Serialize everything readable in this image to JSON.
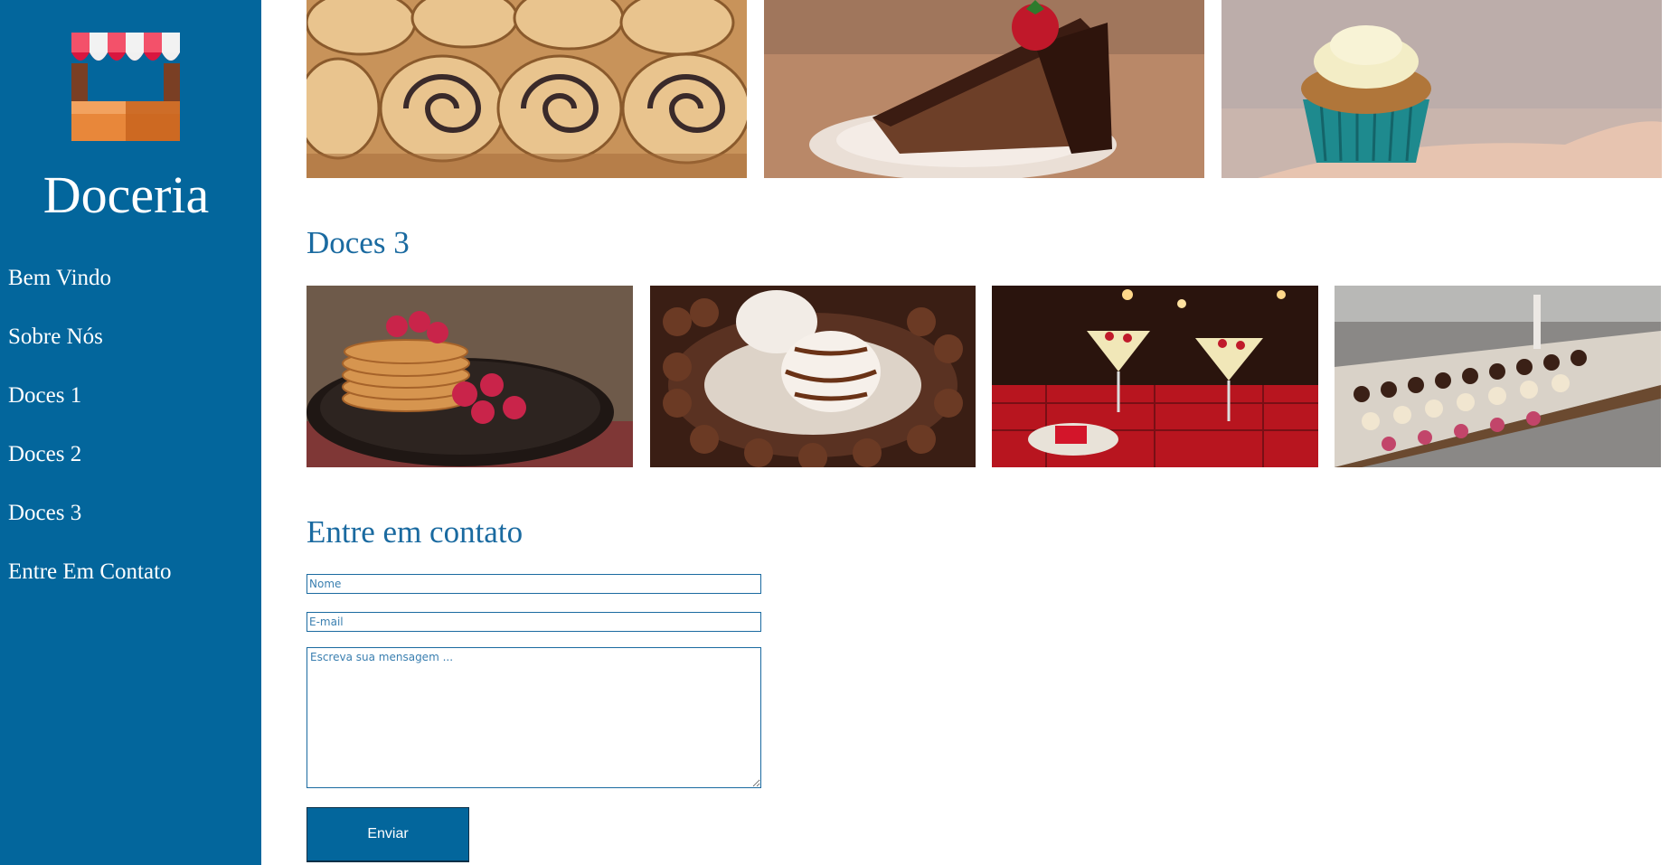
{
  "brand": {
    "logo_icon": "bakery-shop-icon",
    "name": "Doceria"
  },
  "nav": {
    "items": [
      {
        "label": "Bem Vindo"
      },
      {
        "label": "Sobre Nós"
      },
      {
        "label": "Doces 1"
      },
      {
        "label": "Doces 2"
      },
      {
        "label": "Doces 3"
      },
      {
        "label": "Entre Em Contato"
      }
    ]
  },
  "gallery_top": {
    "photos": [
      "poppy-seed-rolls-photo",
      "chocolate-cake-strawberry-photo",
      "cupcake-in-hand-photo"
    ]
  },
  "doces3": {
    "title": "Doces 3",
    "photos": [
      "pancakes-raspberries-photo",
      "chocolate-coconut-dessert-photo",
      "christmas-cocktails-photo",
      "pastry-display-counter-photo"
    ]
  },
  "contact": {
    "title": "Entre em contato",
    "name_placeholder": "Nome",
    "email_placeholder": "E-mail",
    "message_placeholder": "Escreva sua mensagem ...",
    "submit_label": "Enviar"
  },
  "colors": {
    "sidebar": "#03669c",
    "heading": "#1a6aa0",
    "text_on_sidebar": "#ffffff"
  }
}
